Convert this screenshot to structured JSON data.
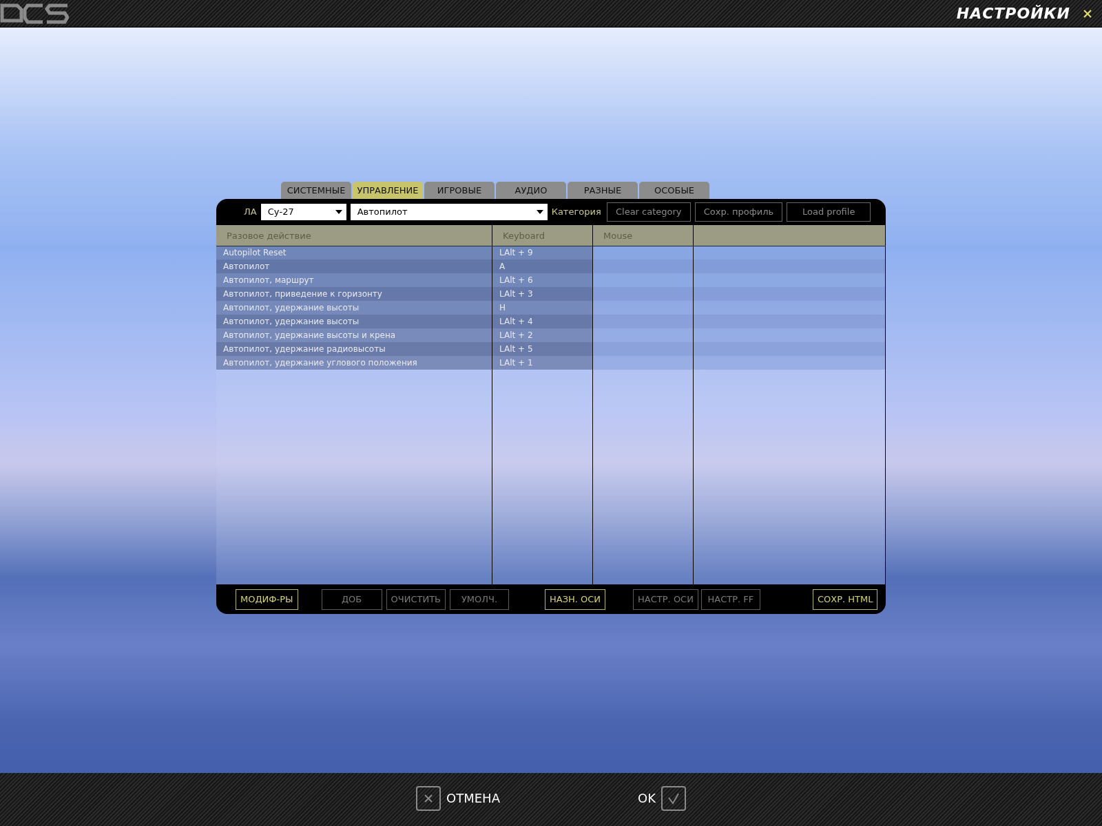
{
  "window": {
    "title": "НАСТРОЙКИ"
  },
  "tabs": [
    {
      "label": "СИСТЕМНЫЕ",
      "selected": false
    },
    {
      "label": "УПРАВЛЕНИЕ",
      "selected": true
    },
    {
      "label": "ИГРОВЫЕ",
      "selected": false
    },
    {
      "label": "АУДИО",
      "selected": false
    },
    {
      "label": "РАЗНЫЕ",
      "selected": false
    },
    {
      "label": "ОСОБЫЕ",
      "selected": false
    }
  ],
  "toolbar": {
    "aircraft_label": "ЛА",
    "aircraft": "Су-27",
    "category": "Автопилот",
    "category_label": "Категория",
    "buttons": [
      "Clear category",
      "Сохр. профиль",
      "Load profile"
    ]
  },
  "table": {
    "columns": [
      "Разовое действие",
      "Keyboard",
      "Mouse"
    ],
    "rows": [
      {
        "action": "Autopilot Reset",
        "keyboard": "LAlt + 9"
      },
      {
        "action": "Автопилот",
        "keyboard": "A"
      },
      {
        "action": "Автопилот, маршрут",
        "keyboard": "LAlt + 6"
      },
      {
        "action": "Автопилот, приведение к горизонту",
        "keyboard": "LAlt + 3"
      },
      {
        "action": "Автопилот, удержание высоты",
        "keyboard": "H"
      },
      {
        "action": "Автопилот, удержание высоты",
        "keyboard": "LAlt + 4"
      },
      {
        "action": "Автопилот, удержание высоты и крена",
        "keyboard": "LAlt + 2"
      },
      {
        "action": "Автопилот, удержание радиовысоты",
        "keyboard": "LAlt + 5"
      },
      {
        "action": "Автопилот, удержание углового положения",
        "keyboard": "LAlt + 1"
      }
    ]
  },
  "bottom_buttons": [
    {
      "label": "МОДИФ-РЫ",
      "disabled": false
    },
    {
      "label": "ДОБ",
      "disabled": true
    },
    {
      "label": "ОЧИСТИТЬ",
      "disabled": true
    },
    {
      "label": "УМОЛЧ.",
      "disabled": true
    },
    {
      "label": "НАЗН. ОСИ",
      "disabled": false
    },
    {
      "label": "НАСТР. ОСИ",
      "disabled": true
    },
    {
      "label": "НАСТР. FF",
      "disabled": true
    },
    {
      "label": "СОХР. HTML",
      "disabled": false
    }
  ],
  "footer": {
    "cancel": "ОТМЕНА",
    "ok": "OK"
  }
}
